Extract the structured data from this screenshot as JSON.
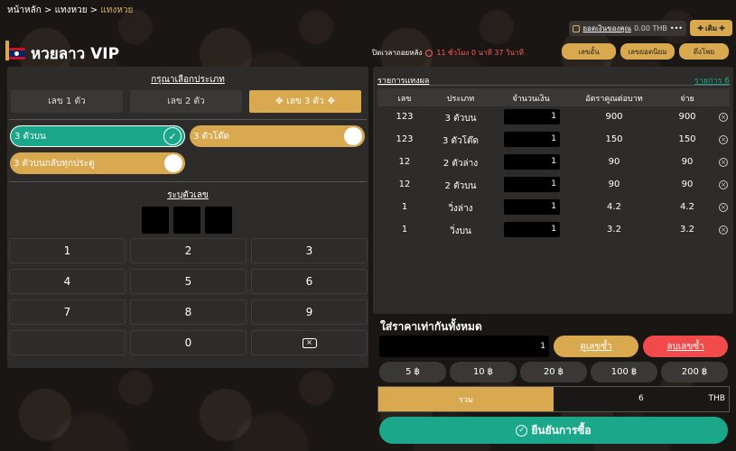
{
  "breadcrumb": {
    "home": "หน้าหลัก",
    "sep1": " > ",
    "middle": "แทงหวย",
    "sep2": " > ",
    "current": "แทงหวย"
  },
  "header": {
    "title": "หวยลาว VIP"
  },
  "balance": {
    "label": "ยอดเงินของคุณ",
    "value": "0.00 THB",
    "more": "•••"
  },
  "topup": {
    "label": "เติม",
    "plus": "✚"
  },
  "timer": {
    "label": "ปิดเวลาถอยหลัง",
    "value": "11 ชั่วโมง 0 นาที 37 วินาที"
  },
  "actions": {
    "btn1": "เลขอั้น",
    "btn2": "เลขยอดนิยม",
    "btn3": "ดึงโพย"
  },
  "select_type": {
    "title": "กรุณาเลือกประเภท",
    "tabs": [
      "เลข 1 ตัว",
      "เลข 2 ตัว",
      "เลข 3 ตัว"
    ],
    "arrow": "✥",
    "options": [
      "3 ตัวบน",
      "3 ตัวโต๊ด",
      "3 ตัวบนกลับทุกประตู"
    ],
    "check": "✓"
  },
  "input_number": {
    "title": "ระบุตัวเลข"
  },
  "numpad": {
    "keys": [
      "1",
      "2",
      "3",
      "4",
      "5",
      "6",
      "7",
      "8",
      "9",
      "",
      "0"
    ],
    "backspace": "×"
  },
  "results": {
    "title": "รายการแทงผล",
    "count_label": "รายการ 6",
    "headers": [
      "เลข",
      "ประเภท",
      "จำนวนเงิน",
      "อัตราคูณต่อบาท",
      "จ่าย"
    ],
    "rows": [
      {
        "num": "123",
        "type": "3 ตัวบน",
        "amount": "1",
        "rate": "900",
        "pay": "900"
      },
      {
        "num": "123",
        "type": "3 ตัวโต๊ด",
        "amount": "1",
        "rate": "150",
        "pay": "150"
      },
      {
        "num": "12",
        "type": "2 ตัวล่าง",
        "amount": "1",
        "rate": "90",
        "pay": "90"
      },
      {
        "num": "12",
        "type": "2 ตัวบน",
        "amount": "1",
        "rate": "90",
        "pay": "90"
      },
      {
        "num": "1",
        "type": "วิ่งล่าง",
        "amount": "1",
        "rate": "4.2",
        "pay": "4.2"
      },
      {
        "num": "1",
        "type": "วิ่งบน",
        "amount": "1",
        "rate": "3.2",
        "pay": "3.2"
      }
    ],
    "remove": "×"
  },
  "same_price": {
    "title": "ใส่ราคาเท่ากันทั้งหมด",
    "value": "1",
    "view_dup": "ดูเลขซ้ำ",
    "remove_dup": "ลบเลขซ้ำ",
    "chips": [
      "5",
      "10",
      "20",
      "100",
      "200"
    ],
    "currency_symbol": "฿"
  },
  "total": {
    "label": "รวม",
    "value": "6",
    "unit": "THB"
  },
  "confirm": {
    "label": "ยืนยันการซื้อ",
    "icon": "✓"
  },
  "colors": {
    "gold": "#d8a94f",
    "green": "#1ba88a",
    "red": "#f04a4a",
    "panel": "#2e2c2b"
  }
}
